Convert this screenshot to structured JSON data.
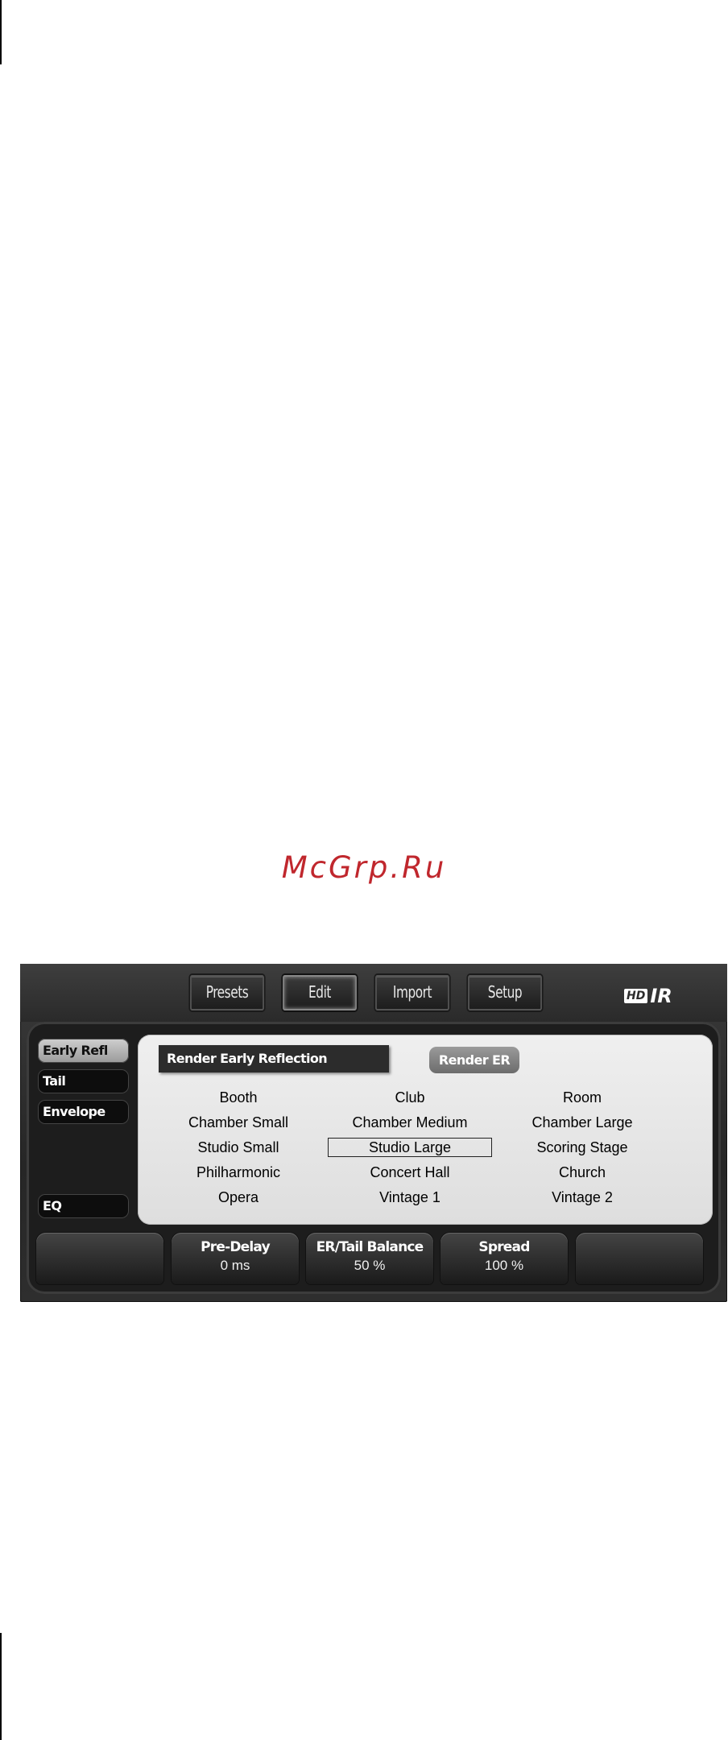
{
  "watermark": "McGrp.Ru",
  "tabs": [
    {
      "label": "Presets",
      "active": false
    },
    {
      "label": "Edit",
      "active": true
    },
    {
      "label": "Import",
      "active": false
    },
    {
      "label": "Setup",
      "active": false
    }
  ],
  "logo": {
    "hd": "HD",
    "ir": "IR"
  },
  "sidebar": {
    "items": [
      {
        "label": "Early Refl",
        "active": true
      },
      {
        "label": "Tail",
        "active": false
      },
      {
        "label": "Envelope",
        "active": false
      },
      {
        "label": "EQ",
        "active": false
      }
    ]
  },
  "render": {
    "label": "Render Early Reflection",
    "button": "Render ER"
  },
  "presets": [
    [
      "Booth",
      "Club",
      "Room"
    ],
    [
      "Chamber Small",
      "Chamber Medium",
      "Chamber Large"
    ],
    [
      "Studio Small",
      "Studio Large",
      "Scoring Stage"
    ],
    [
      "Philharmonic",
      "Concert Hall",
      "Church"
    ],
    [
      "Opera",
      "Vintage 1",
      "Vintage 2"
    ]
  ],
  "selected_preset": "Studio Large",
  "params": [
    {
      "name": "",
      "value": ""
    },
    {
      "name": "Pre-Delay",
      "value": "0 ms"
    },
    {
      "name": "ER/Tail Balance",
      "value": "50 %"
    },
    {
      "name": "Spread",
      "value": "100 %"
    },
    {
      "name": "",
      "value": ""
    }
  ]
}
